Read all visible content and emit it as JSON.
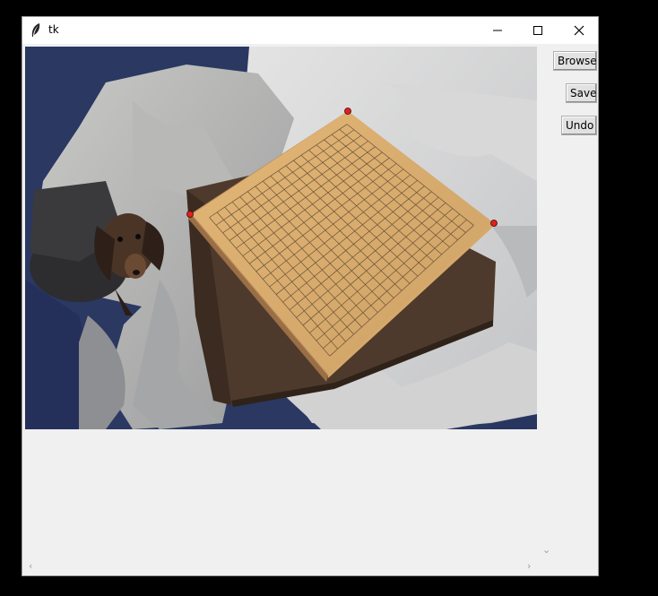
{
  "window": {
    "title": "tk",
    "controls": {
      "minimize": "—",
      "maximize": "☐",
      "close": "✕"
    }
  },
  "toolbar": {
    "browse_label": "Browse",
    "save_label": "Save",
    "undo_label": "Undo"
  },
  "scrollbars": {
    "up_arrow": "",
    "down_arrow": "⌄",
    "left_arrow": "‹",
    "right_arrow": "›"
  },
  "canvas": {
    "image_subject": "go board on brown mat with dachshund on bedding",
    "marker_color": "#e02020"
  }
}
